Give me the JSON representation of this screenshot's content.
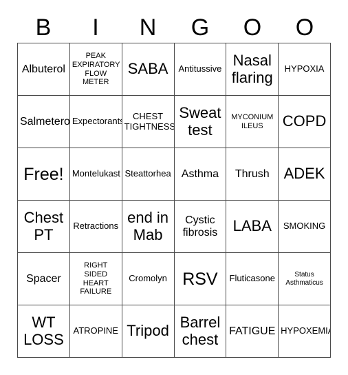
{
  "card": {
    "header_letters": [
      "B",
      "I",
      "N",
      "G",
      "O",
      "O"
    ],
    "columns": 6,
    "rows": 6,
    "border_color": "#4a4a4a",
    "text_color": "#000000",
    "background_color": "#ffffff",
    "free_space": "Free!",
    "cells": [
      [
        {
          "text": "Albuterol",
          "size": "md"
        },
        {
          "text": "PEAK EXPIRATORY FLOW METER",
          "size": "xs"
        },
        {
          "text": "SABA",
          "size": "lg"
        },
        {
          "text": "Antitussive",
          "size": "sm"
        },
        {
          "text": "Nasal flaring",
          "size": "lg"
        },
        {
          "text": "HYPOXIA",
          "size": "sm"
        }
      ],
      [
        {
          "text": "Salmeterol",
          "size": "md"
        },
        {
          "text": "Expectorants",
          "size": "sm"
        },
        {
          "text": "CHEST TIGHTNESS",
          "size": "sm"
        },
        {
          "text": "Sweat test",
          "size": "lg"
        },
        {
          "text": "MYCONIUM ILEUS",
          "size": "xs"
        },
        {
          "text": "COPD",
          "size": "lg"
        }
      ],
      [
        {
          "text": "Free!",
          "size": "xl"
        },
        {
          "text": "Montelukast",
          "size": "sm"
        },
        {
          "text": "Steattorhea",
          "size": "sm"
        },
        {
          "text": "Asthma",
          "size": "md"
        },
        {
          "text": "Thrush",
          "size": "md"
        },
        {
          "text": "ADEK",
          "size": "lg"
        }
      ],
      [
        {
          "text": "Chest PT",
          "size": "lg"
        },
        {
          "text": "Retractions",
          "size": "sm"
        },
        {
          "text": "end in Mab",
          "size": "lg"
        },
        {
          "text": "Cystic fibrosis",
          "size": "md"
        },
        {
          "text": "LABA",
          "size": "lg"
        },
        {
          "text": "SMOKING",
          "size": "sm"
        }
      ],
      [
        {
          "text": "Spacer",
          "size": "md"
        },
        {
          "text": "RIGHT SIDED HEART FAILURE",
          "size": "xs"
        },
        {
          "text": "Cromolyn",
          "size": "sm"
        },
        {
          "text": "RSV",
          "size": "xl"
        },
        {
          "text": "Fluticasone",
          "size": "sm"
        },
        {
          "text": "Status Asthmaticus",
          "size": "xxs"
        }
      ],
      [
        {
          "text": "WT LOSS",
          "size": "lg"
        },
        {
          "text": "ATROPINE",
          "size": "sm"
        },
        {
          "text": "Tripod",
          "size": "lg"
        },
        {
          "text": "Barrel chest",
          "size": "lg"
        },
        {
          "text": "FATIGUE",
          "size": "md"
        },
        {
          "text": "HYPOXEMIA",
          "size": "sm"
        }
      ]
    ]
  }
}
